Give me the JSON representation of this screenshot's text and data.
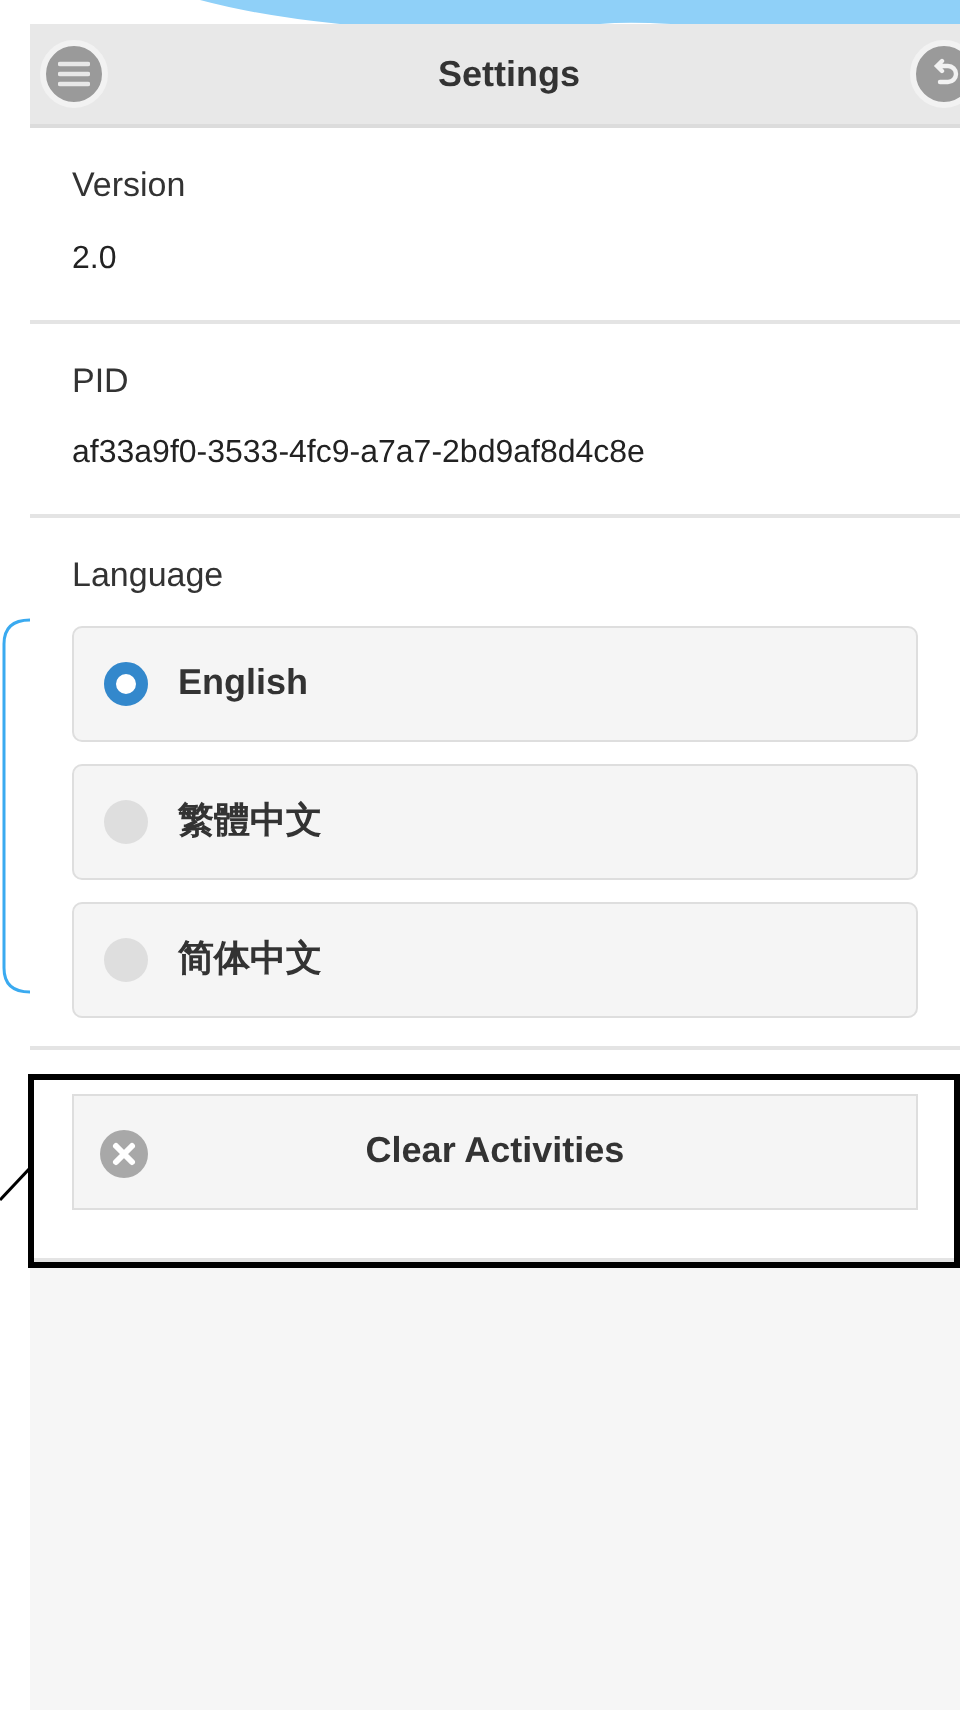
{
  "header": {
    "title": "Settings"
  },
  "info": [
    {
      "label": "Version",
      "value": "2.0"
    },
    {
      "label": "PID",
      "value": "af33a9f0-3533-4fc9-a7a7-2bd9af8d4c8e"
    }
  ],
  "language": {
    "label": "Language",
    "options": [
      {
        "label": "English",
        "selected": true
      },
      {
        "label": "繁體中文",
        "selected": false
      },
      {
        "label": "简体中文",
        "selected": false
      }
    ]
  },
  "actions": [
    {
      "label": "Clear Activities"
    }
  ]
}
